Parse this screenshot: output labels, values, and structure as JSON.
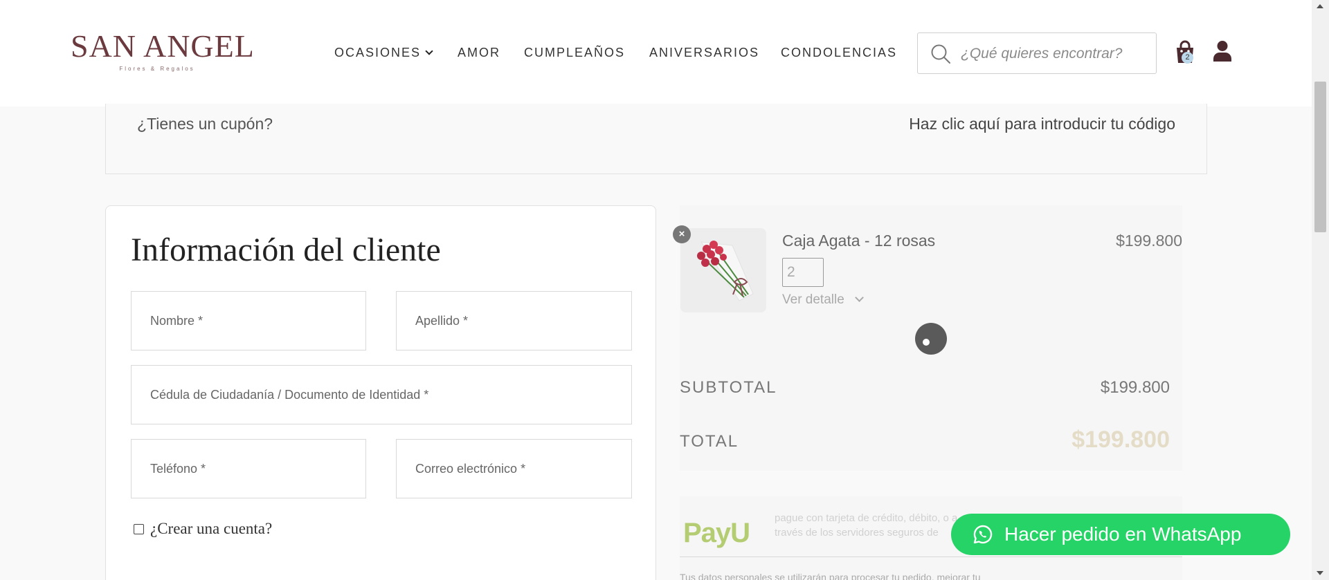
{
  "header": {
    "logo": {
      "name": "SAN ANGEL",
      "tagline": "Flores & Regalos"
    },
    "nav": [
      {
        "label": "OCASIONES",
        "has_dropdown": true
      },
      {
        "label": "AMOR"
      },
      {
        "label": "CUMPLEAÑOS"
      },
      {
        "label": "ANIVERSARIOS"
      },
      {
        "label": "CONDOLENCIAS"
      }
    ],
    "search": {
      "placeholder": "¿Qué quieres encontrar?"
    },
    "cart": {
      "count": "2",
      "icon": "shopping-bag-icon"
    },
    "user": {
      "icon": "user-icon"
    }
  },
  "coupon": {
    "question": "¿Tienes un cupón?",
    "link": "Haz clic aquí para introducir tu código"
  },
  "customer": {
    "title": "Información del cliente",
    "fields": {
      "first_name": "Nombre *",
      "last_name": "Apellido *",
      "id_document": "Cédula de Ciudadanía / Documento de Identidad *",
      "phone": "Teléfono *",
      "email": "Correo electrónico *"
    },
    "create_account": "¿Crear una cuenta?"
  },
  "order": {
    "item": {
      "name": "Caja Agata - 12 rosas",
      "price": "$199.800",
      "quantity": "2",
      "detail_link": "Ver detalle",
      "remove": "×"
    },
    "subtotal_label": "SUBTOTAL",
    "subtotal_value": "$199.800",
    "total_label": "TOTAL",
    "total_value": "$199.800"
  },
  "payment": {
    "logo": "PayU",
    "description": "pague con tarjeta de crédito, débito, o a través de los servidores seguros de",
    "bottom_text": "Tus datos personales se utilizarán para procesar tu pedido, mejorar tu"
  },
  "whatsapp": {
    "label": "Hacer pedido en WhatsApp",
    "color": "#25d366"
  },
  "colors": {
    "brand": "#6b3a3f",
    "accent": "#25d366"
  }
}
